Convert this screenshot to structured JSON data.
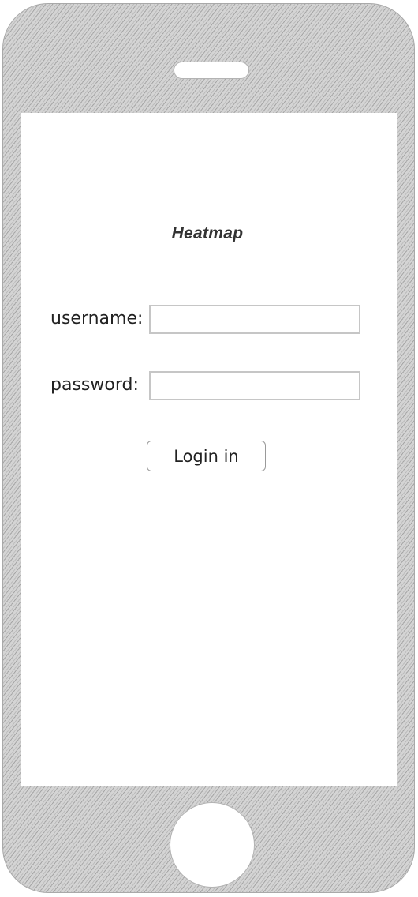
{
  "login": {
    "title": "Heatmap",
    "username_label": "username:",
    "username_value": "",
    "password_label": "password:",
    "password_value": "",
    "login_button_label": "Login in"
  },
  "device": {
    "frame_color": "#d3d3d3",
    "screen_color": "#ffffff"
  }
}
